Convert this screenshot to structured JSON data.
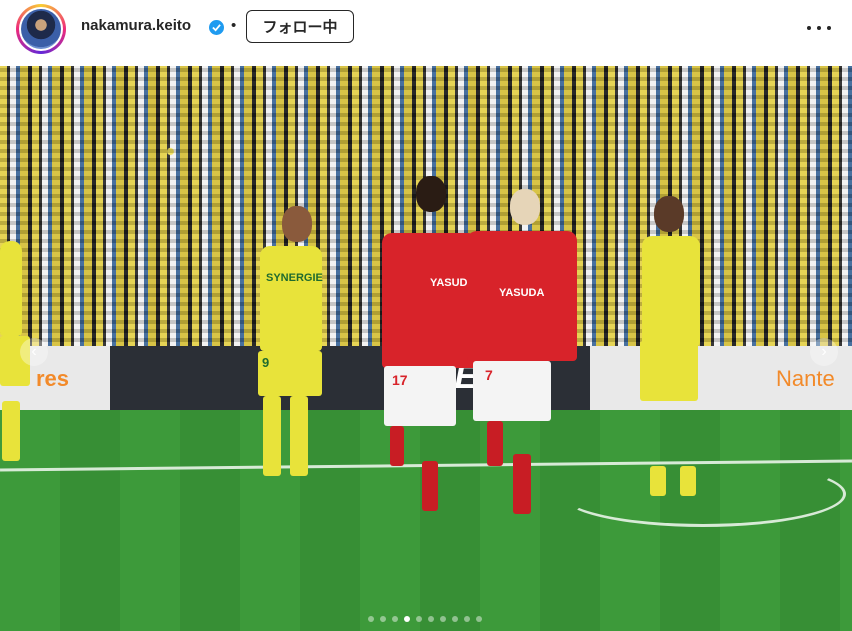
{
  "header": {
    "username": "nakamura.keito",
    "separator": "•",
    "follow_label": "フォロー中"
  },
  "photo": {
    "board_left": "res",
    "board_mid": "UE 1",
    "board_right": "Nante",
    "shirt_number_1": "17",
    "shirt_number_2": "7",
    "shirt_number_3": "9",
    "sponsor_red": "YASUDA",
    "sponsor_yellow": "SYNERGIE",
    "carousel_count": 10,
    "carousel_active_index": 3
  },
  "colors": {
    "verified": "#1f9bf0",
    "reims_red": "#d8232a",
    "nantes_yellow": "#e8e33a"
  }
}
